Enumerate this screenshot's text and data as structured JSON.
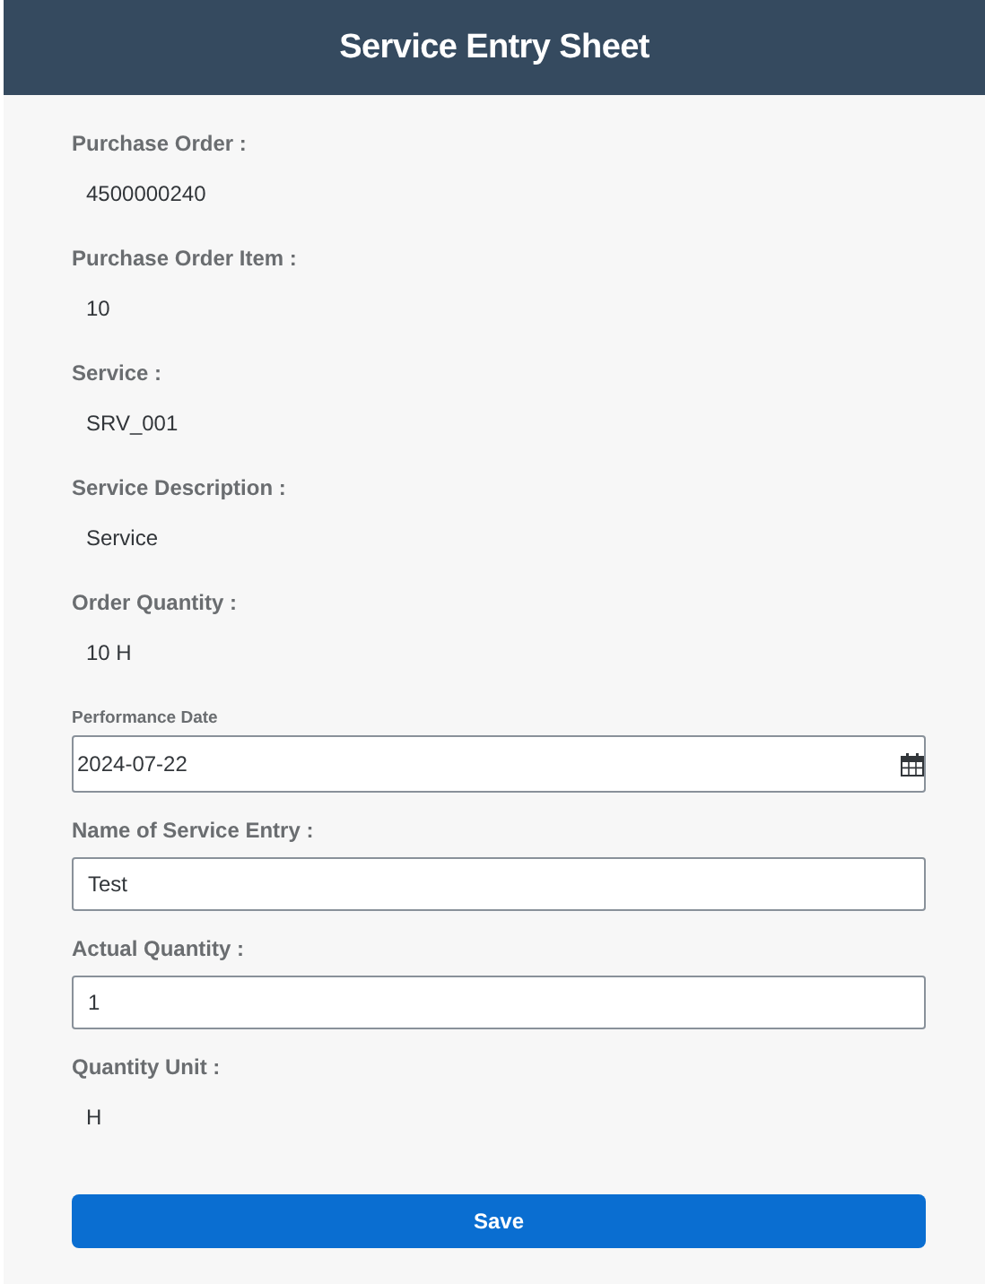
{
  "header": {
    "title": "Service Entry Sheet"
  },
  "fields": [
    {
      "kind": "display",
      "label": "Purchase Order :",
      "value": "4500000240"
    },
    {
      "kind": "display",
      "label": "Purchase Order Item :",
      "value": "10"
    },
    {
      "kind": "display",
      "label": "Service :",
      "value": "SRV_001"
    },
    {
      "kind": "display",
      "label": "Service Description :",
      "value": "Service"
    },
    {
      "kind": "display",
      "label": "Order Quantity :",
      "value": "10 H"
    },
    {
      "kind": "date",
      "label": "Performance Date",
      "value": "2024-07-22"
    },
    {
      "kind": "input",
      "label": "Name of Service Entry :",
      "value": "Test"
    },
    {
      "kind": "input",
      "label": "Actual Quantity :",
      "value": "1"
    },
    {
      "kind": "display",
      "label": "Quantity Unit :",
      "value": "H"
    }
  ],
  "save_button": "Save"
}
